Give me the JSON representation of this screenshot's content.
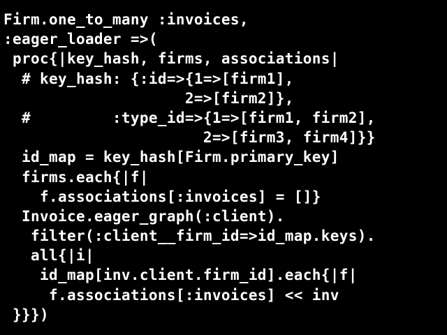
{
  "colors": {
    "background": "#000000",
    "text": "#ffffff"
  },
  "code": {
    "lines": [
      "Firm.one_to_many :invoices,",
      ":eager_loader =>(",
      " proc{|key_hash, firms, associations|",
      "  # key_hash: {:id=>{1=>[firm1],",
      "                    2=>[firm2]},",
      "  #         :type_id=>{1=>[firm1, firm2],",
      "                      2=>[firm3, firm4]}}",
      "  id_map = key_hash[Firm.primary_key]",
      "  firms.each{|f|",
      "    f.associations[:invoices] = []}",
      "  Invoice.eager_graph(:client).",
      "   filter(:client__firm_id=>id_map.keys).",
      "   all{|i|",
      "    id_map[inv.client.firm_id].each{|f|",
      "     f.associations[:invoices] << inv",
      " }}})"
    ]
  }
}
